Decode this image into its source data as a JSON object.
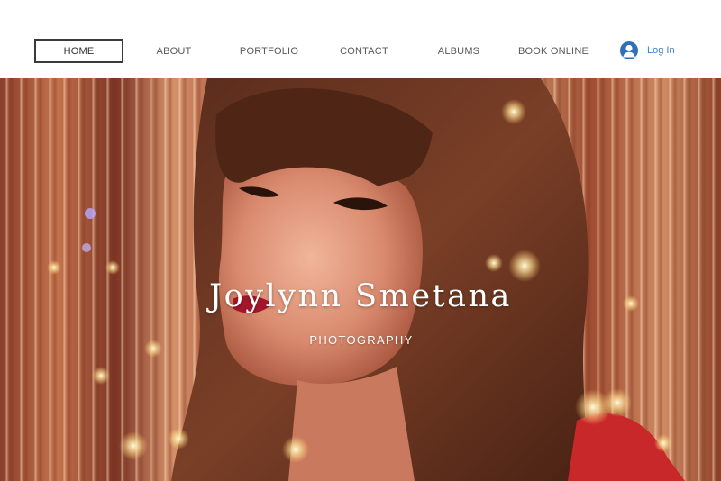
{
  "nav": {
    "items": [
      {
        "label": "HOME",
        "active": true
      },
      {
        "label": "ABOUT"
      },
      {
        "label": "PORTFOLIO"
      },
      {
        "label": "CONTACT"
      },
      {
        "label": "ALBUMS"
      },
      {
        "label": "BOOK ONLINE"
      }
    ]
  },
  "login": {
    "label": "Log In",
    "icon": "user-avatar-icon"
  },
  "hero": {
    "title": "Joylynn Smetana",
    "subtitle": "PHOTOGRAPHY"
  },
  "colors": {
    "nav_text": "#595959",
    "active_border": "#3a3a3a",
    "login_text": "#3d7fc2",
    "avatar": "#2f6fb5",
    "hero_text": "#ffffff"
  }
}
